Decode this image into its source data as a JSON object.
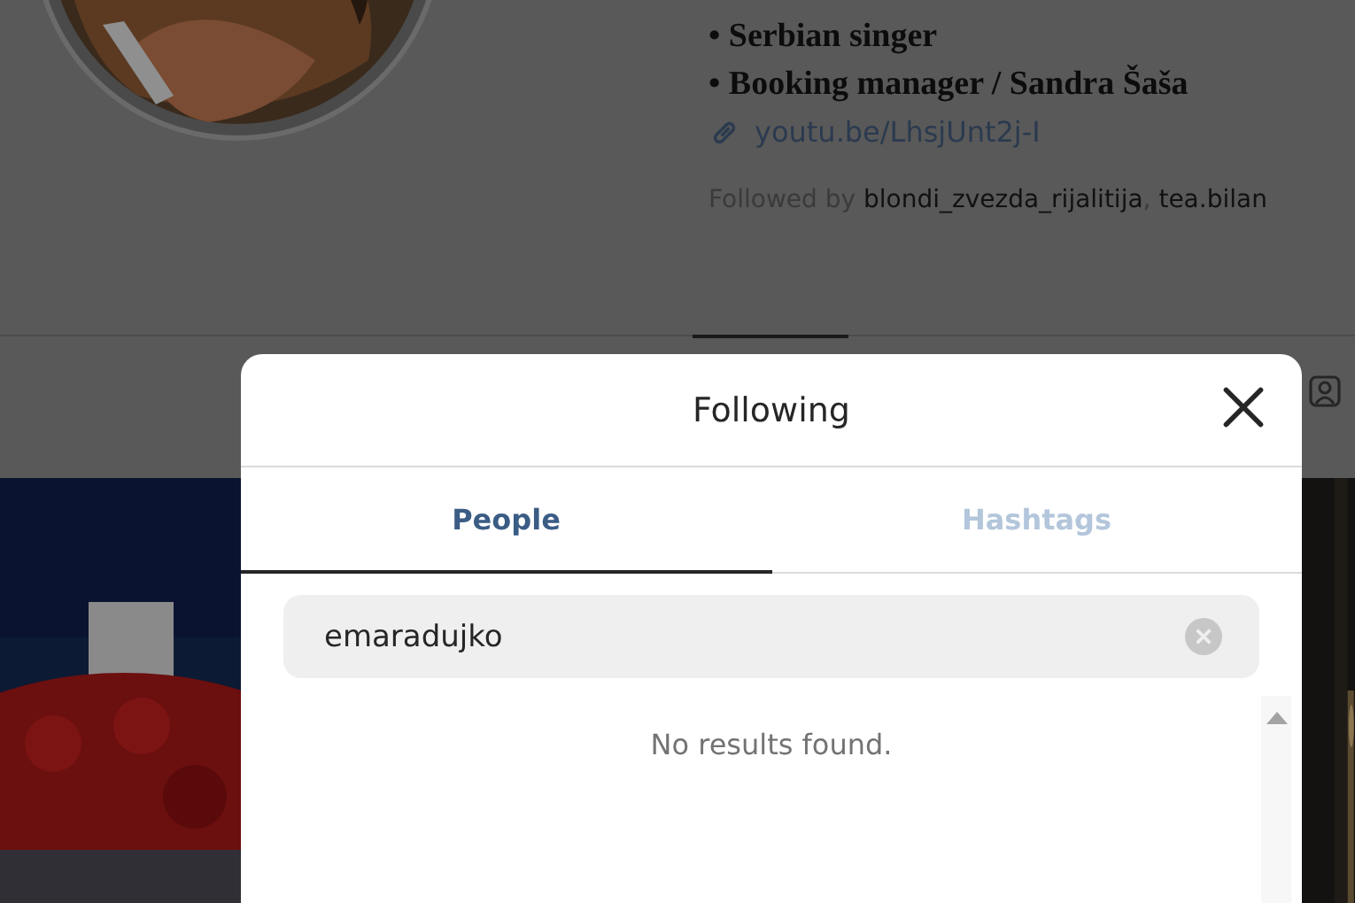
{
  "profile": {
    "bio_lines": [
      "• Serbian singer",
      "• Booking manager / Sandra Šaša"
    ],
    "link": "youtu.be/LhsjUnt2j-I",
    "followed_by": "Followed by **blondi_zvezda_rijalitija**, **tea.bilan**"
  },
  "modal": {
    "title": "Following",
    "tabs": [
      {
        "label": "People",
        "selected": true
      },
      {
        "label": "Hashtags",
        "selected": false
      }
    ],
    "search": {
      "value": "emaradujko"
    },
    "empty_message": "No results found."
  }
}
